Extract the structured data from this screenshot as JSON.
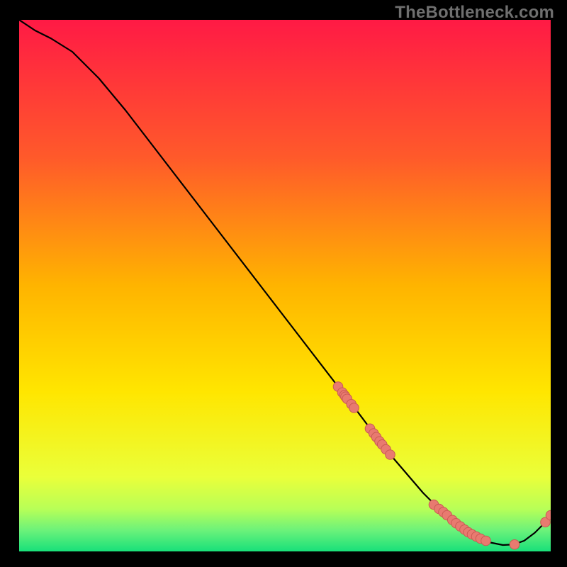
{
  "watermark": "TheBottleneck.com",
  "colors": {
    "gradient_top": "#ff1a45",
    "gradient_mid": "#ffd400",
    "gradient_bottom": "#18e07a",
    "curve": "#000000",
    "marker_fill": "#e87a70",
    "marker_stroke": "#c95b53",
    "background": "#000000"
  },
  "chart_data": {
    "type": "line",
    "title": "",
    "xlabel": "",
    "ylabel": "",
    "xlim": [
      0,
      100
    ],
    "ylim": [
      0,
      100
    ],
    "grid": false,
    "legend": false,
    "curve": {
      "x": [
        0,
        3,
        6,
        10,
        15,
        20,
        25,
        30,
        35,
        40,
        45,
        50,
        55,
        60,
        62,
        65,
        68,
        70,
        73,
        76,
        79,
        82,
        85,
        88,
        91,
        93,
        95,
        97,
        99,
        100
      ],
      "y": [
        100,
        98,
        96.5,
        94,
        89,
        83,
        76.5,
        70,
        63.5,
        57,
        50.5,
        44,
        37.5,
        31,
        28.5,
        24.5,
        20.5,
        18,
        14.5,
        11,
        8,
        5.2,
        3.2,
        1.8,
        1.2,
        1.3,
        2.0,
        3.5,
        5.5,
        6.8
      ]
    },
    "markers": [
      {
        "x": 60.0,
        "y": 31.0
      },
      {
        "x": 60.8,
        "y": 29.9
      },
      {
        "x": 61.2,
        "y": 29.4
      },
      {
        "x": 61.4,
        "y": 29.1
      },
      {
        "x": 61.7,
        "y": 28.7
      },
      {
        "x": 62.5,
        "y": 27.7
      },
      {
        "x": 63.0,
        "y": 27.0
      },
      {
        "x": 66.0,
        "y": 23.1
      },
      {
        "x": 66.7,
        "y": 22.2
      },
      {
        "x": 67.2,
        "y": 21.5
      },
      {
        "x": 67.8,
        "y": 20.7
      },
      {
        "x": 68.3,
        "y": 20.1
      },
      {
        "x": 69.0,
        "y": 19.2
      },
      {
        "x": 69.8,
        "y": 18.2
      },
      {
        "x": 78.0,
        "y": 8.8
      },
      {
        "x": 79.0,
        "y": 8.0
      },
      {
        "x": 79.8,
        "y": 7.4
      },
      {
        "x": 80.5,
        "y": 6.8
      },
      {
        "x": 81.5,
        "y": 5.9
      },
      {
        "x": 82.2,
        "y": 5.3
      },
      {
        "x": 83.0,
        "y": 4.7
      },
      {
        "x": 83.8,
        "y": 4.1
      },
      {
        "x": 84.5,
        "y": 3.6
      },
      {
        "x": 85.2,
        "y": 3.2
      },
      {
        "x": 86.0,
        "y": 2.8
      },
      {
        "x": 86.8,
        "y": 2.4
      },
      {
        "x": 87.8,
        "y": 2.0
      },
      {
        "x": 93.2,
        "y": 1.3
      },
      {
        "x": 99.0,
        "y": 5.5
      },
      {
        "x": 100.0,
        "y": 6.8
      }
    ]
  }
}
